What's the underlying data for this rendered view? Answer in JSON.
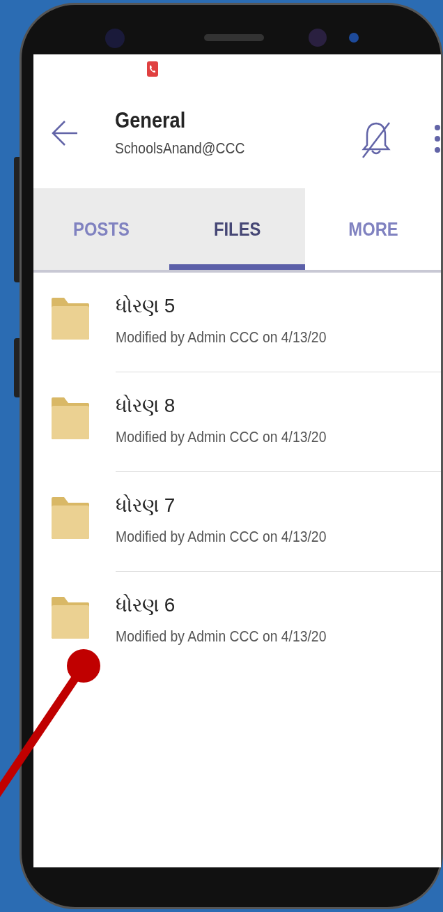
{
  "header": {
    "title": "General",
    "subtitle": "SchoolsAnand@CCC"
  },
  "tabs": [
    {
      "label": "POSTS",
      "selected": false
    },
    {
      "label": "FILES",
      "selected": true
    },
    {
      "label": "MORE",
      "selected": false
    }
  ],
  "files": [
    {
      "name": "ધોરણ 5",
      "modified": "Modified by Admin CCC on 4/13/20"
    },
    {
      "name": "ધોરણ 8",
      "modified": "Modified by Admin CCC on 4/13/20"
    },
    {
      "name": "ધોરણ 7",
      "modified": "Modified by Admin CCC on 4/13/20"
    },
    {
      "name": "ધોરણ 6",
      "modified": "Modified by Admin CCC on 4/13/20"
    }
  ]
}
